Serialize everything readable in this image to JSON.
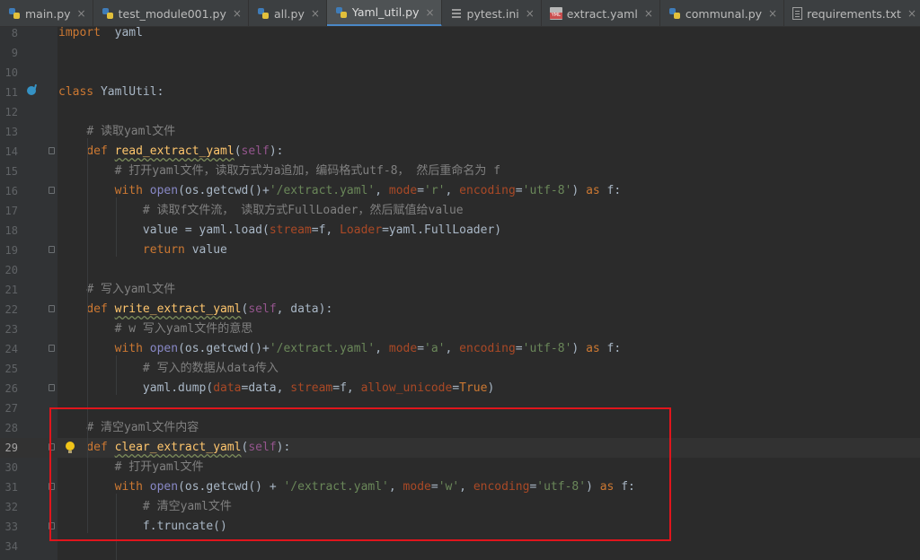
{
  "tabs": [
    {
      "label": "main.py",
      "icon": "python-file-icon",
      "active": false
    },
    {
      "label": "test_module001.py",
      "icon": "python-file-icon",
      "active": false
    },
    {
      "label": "all.py",
      "icon": "python-file-icon",
      "active": false
    },
    {
      "label": "Yaml_util.py",
      "icon": "python-file-icon",
      "active": true
    },
    {
      "label": "pytest.ini",
      "icon": "ini-file-icon",
      "active": false
    },
    {
      "label": "extract.yaml",
      "icon": "yaml-file-icon",
      "active": false
    },
    {
      "label": "communal.py",
      "icon": "python-file-icon",
      "active": false
    },
    {
      "label": "requirements.txt",
      "icon": "text-file-icon",
      "active": false
    }
  ],
  "tab_close_glyph": "×",
  "colors": {
    "keyword": "#cc7832",
    "function": "#ffc66d",
    "string": "#6a8759",
    "comment": "#808080",
    "self": "#94558d",
    "param": "#aa4926",
    "builtin": "#8888c6",
    "highlight_box": "#e0151c",
    "active_tab_underline": "#4a88c7"
  },
  "editor": {
    "current_line": 29,
    "lines": [
      {
        "n": "8",
        "tokens": [
          [
            "kw",
            "import"
          ],
          [
            "",
            "  yaml"
          ]
        ]
      },
      {
        "n": "9",
        "tokens": []
      },
      {
        "n": "10",
        "tokens": []
      },
      {
        "n": "11",
        "tokens": [
          [
            "kw",
            "class"
          ],
          [
            "",
            " YamlUtil:"
          ]
        ],
        "gutter_icon": "run-icon"
      },
      {
        "n": "12",
        "tokens": []
      },
      {
        "n": "13",
        "tokens": [
          [
            "",
            "    "
          ],
          [
            "cm",
            "# 读取yaml文件"
          ]
        ]
      },
      {
        "n": "14",
        "tokens": [
          [
            "",
            "    "
          ],
          [
            "kw",
            "def"
          ],
          [
            "",
            " "
          ],
          [
            "fn",
            "read_extract_yaml"
          ],
          [
            "",
            "("
          ],
          [
            "self",
            "self"
          ],
          [
            "",
            "):"
          ]
        ],
        "fold": true
      },
      {
        "n": "15",
        "tokens": [
          [
            "",
            "        "
          ],
          [
            "cm",
            "# 打开yaml文件，读取方式为a追加，编码格式utf-8， 然后重命名为 f"
          ]
        ]
      },
      {
        "n": "16",
        "tokens": [
          [
            "",
            "        "
          ],
          [
            "kw",
            "with"
          ],
          [
            "",
            " "
          ],
          [
            "builtin",
            "open"
          ],
          [
            "",
            "(os.getcwd()+"
          ],
          [
            "str",
            "'/extract.yaml'"
          ],
          [
            "",
            ", "
          ],
          [
            "param",
            "mode"
          ],
          [
            "",
            "="
          ],
          [
            "str",
            "'r'"
          ],
          [
            "",
            ", "
          ],
          [
            "param",
            "encoding"
          ],
          [
            "",
            "="
          ],
          [
            "str",
            "'utf-8'"
          ],
          [
            "",
            ") "
          ],
          [
            "kw",
            "as"
          ],
          [
            "",
            " f:"
          ]
        ],
        "fold": true
      },
      {
        "n": "17",
        "tokens": [
          [
            "",
            "            "
          ],
          [
            "cm",
            "# 读取f文件流， 读取方式FullLoader，然后赋值给value"
          ]
        ]
      },
      {
        "n": "18",
        "tokens": [
          [
            "",
            "            value = yaml.load("
          ],
          [
            "param",
            "stream"
          ],
          [
            "",
            "=f, "
          ],
          [
            "param",
            "Loader"
          ],
          [
            "",
            "=yaml.FullLoader)"
          ]
        ]
      },
      {
        "n": "19",
        "tokens": [
          [
            "",
            "            "
          ],
          [
            "kw",
            "return"
          ],
          [
            "",
            " value"
          ]
        ],
        "fold": true
      },
      {
        "n": "20",
        "tokens": []
      },
      {
        "n": "21",
        "tokens": [
          [
            "",
            "    "
          ],
          [
            "cm",
            "# 写入yaml文件"
          ]
        ]
      },
      {
        "n": "22",
        "tokens": [
          [
            "",
            "    "
          ],
          [
            "kw",
            "def"
          ],
          [
            "",
            " "
          ],
          [
            "fn",
            "write_extract_yaml"
          ],
          [
            "",
            "("
          ],
          [
            "self",
            "self"
          ],
          [
            "",
            ", data):"
          ]
        ],
        "fold": true
      },
      {
        "n": "23",
        "tokens": [
          [
            "",
            "        "
          ],
          [
            "cm",
            "# w 写入yaml文件的意思"
          ]
        ]
      },
      {
        "n": "24",
        "tokens": [
          [
            "",
            "        "
          ],
          [
            "kw",
            "with"
          ],
          [
            "",
            " "
          ],
          [
            "builtin",
            "open"
          ],
          [
            "",
            "(os.getcwd()+"
          ],
          [
            "str",
            "'/extract.yaml'"
          ],
          [
            "",
            ", "
          ],
          [
            "param",
            "mode"
          ],
          [
            "",
            "="
          ],
          [
            "str",
            "'a'"
          ],
          [
            "",
            ", "
          ],
          [
            "param",
            "encoding"
          ],
          [
            "",
            "="
          ],
          [
            "str",
            "'utf-8'"
          ],
          [
            "",
            ") "
          ],
          [
            "kw",
            "as"
          ],
          [
            "",
            " f:"
          ]
        ],
        "fold": true
      },
      {
        "n": "25",
        "tokens": [
          [
            "",
            "            "
          ],
          [
            "cm",
            "# 写入的数据从data传入"
          ]
        ]
      },
      {
        "n": "26",
        "tokens": [
          [
            "",
            "            yaml.dump("
          ],
          [
            "param",
            "data"
          ],
          [
            "",
            "=data, "
          ],
          [
            "param",
            "stream"
          ],
          [
            "",
            "=f, "
          ],
          [
            "param",
            "allow_unicode"
          ],
          [
            "",
            "="
          ],
          [
            "kw",
            "True"
          ],
          [
            "",
            ")"
          ]
        ],
        "fold": true
      },
      {
        "n": "27",
        "tokens": []
      },
      {
        "n": "28",
        "tokens": [
          [
            "",
            "    "
          ],
          [
            "cm",
            "# 清空yaml文件内容"
          ]
        ]
      },
      {
        "n": "29",
        "tokens": [
          [
            "",
            "    "
          ],
          [
            "kw",
            "def"
          ],
          [
            "",
            " "
          ],
          [
            "fn",
            "clear_extract_yaml"
          ],
          [
            "",
            "("
          ],
          [
            "self",
            "self"
          ],
          [
            "",
            "):"
          ]
        ],
        "fold": true,
        "bulb": true
      },
      {
        "n": "30",
        "tokens": [
          [
            "",
            "        "
          ],
          [
            "cm",
            "# 打开yaml文件"
          ]
        ]
      },
      {
        "n": "31",
        "tokens": [
          [
            "",
            "        "
          ],
          [
            "kw",
            "with"
          ],
          [
            "",
            " "
          ],
          [
            "builtin",
            "open"
          ],
          [
            "",
            "(os.getcwd() + "
          ],
          [
            "str",
            "'/extract.yaml'"
          ],
          [
            "",
            ", "
          ],
          [
            "param",
            "mode"
          ],
          [
            "",
            "="
          ],
          [
            "str",
            "'w'"
          ],
          [
            "",
            ", "
          ],
          [
            "param",
            "encoding"
          ],
          [
            "",
            "="
          ],
          [
            "str",
            "'utf-8'"
          ],
          [
            "",
            ") "
          ],
          [
            "kw",
            "as"
          ],
          [
            "",
            " f:"
          ]
        ],
        "fold": true
      },
      {
        "n": "32",
        "tokens": [
          [
            "",
            "            "
          ],
          [
            "cm",
            "# 清空yaml文件"
          ]
        ]
      },
      {
        "n": "33",
        "tokens": [
          [
            "",
            "            f.truncate()"
          ]
        ],
        "fold": true
      },
      {
        "n": "34",
        "tokens": []
      }
    ]
  }
}
